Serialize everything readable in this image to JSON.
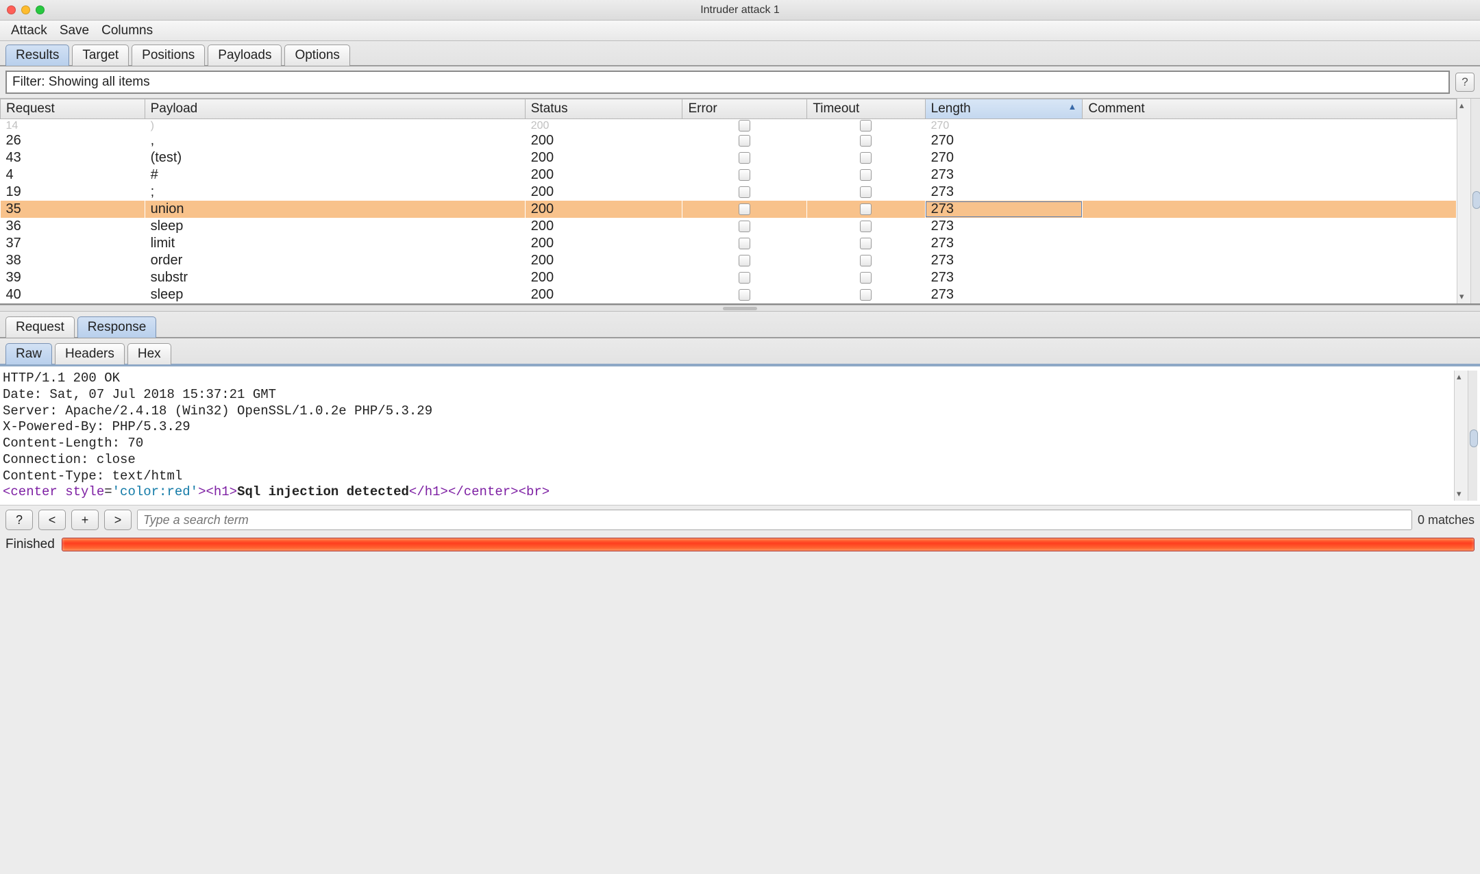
{
  "window": {
    "title": "Intruder attack 1"
  },
  "menu": {
    "attack": "Attack",
    "save": "Save",
    "columns": "Columns"
  },
  "tabs": {
    "items": [
      "Results",
      "Target",
      "Positions",
      "Payloads",
      "Options"
    ],
    "active": 0
  },
  "filter": {
    "text": "Filter: Showing all items"
  },
  "columns": {
    "request": "Request",
    "payload": "Payload",
    "status": "Status",
    "error": "Error",
    "timeout": "Timeout",
    "length": "Length",
    "comment": "Comment",
    "sort_indicator": "▲"
  },
  "rows": [
    {
      "req": "26",
      "payload": ",",
      "status": "200",
      "length": "270",
      "sel": false
    },
    {
      "req": "43",
      "payload": "(test)",
      "status": "200",
      "length": "270",
      "sel": false
    },
    {
      "req": "4",
      "payload": "#",
      "status": "200",
      "length": "273",
      "sel": false
    },
    {
      "req": "19",
      "payload": ";",
      "status": "200",
      "length": "273",
      "sel": false
    },
    {
      "req": "35",
      "payload": "union",
      "status": "200",
      "length": "273",
      "sel": true
    },
    {
      "req": "36",
      "payload": "sleep",
      "status": "200",
      "length": "273",
      "sel": false
    },
    {
      "req": "37",
      "payload": "limit",
      "status": "200",
      "length": "273",
      "sel": false
    },
    {
      "req": "38",
      "payload": "order",
      "status": "200",
      "length": "273",
      "sel": false
    },
    {
      "req": "39",
      "payload": "substr",
      "status": "200",
      "length": "273",
      "sel": false
    },
    {
      "req": "40",
      "payload": "sleep",
      "status": "200",
      "length": "273",
      "sel": false
    }
  ],
  "peek": {
    "req": "14",
    "payload": ")",
    "status": "200",
    "length": "270"
  },
  "detail_tabs": {
    "items": [
      "Request",
      "Response"
    ],
    "active": 1
  },
  "view_tabs": {
    "items": [
      "Raw",
      "Headers",
      "Hex"
    ],
    "active": 0
  },
  "response": {
    "lines": [
      "HTTP/1.1 200 OK",
      "Date: Sat, 07 Jul 2018 15:37:21 GMT",
      "Server: Apache/2.4.18 (Win32) OpenSSL/1.0.2e PHP/5.3.29",
      "X-Powered-By: PHP/5.3.29",
      "Content-Length: 70",
      "Connection: close",
      "Content-Type: text/html",
      ""
    ],
    "html": {
      "open_center": "<center ",
      "attr": "style",
      "eq": "=",
      "val": "'color:red'",
      "close_ang": ">",
      "open_h1": "<h1>",
      "bold": "Sql injection detected",
      "close_h1": "</h1>",
      "close_center": "</center>",
      "br": "<br>"
    }
  },
  "search": {
    "placeholder": "Type a search term",
    "matches": "0 matches",
    "help": "?",
    "prev": "<",
    "add": "+",
    "next": ">"
  },
  "status": {
    "label": "Finished"
  }
}
